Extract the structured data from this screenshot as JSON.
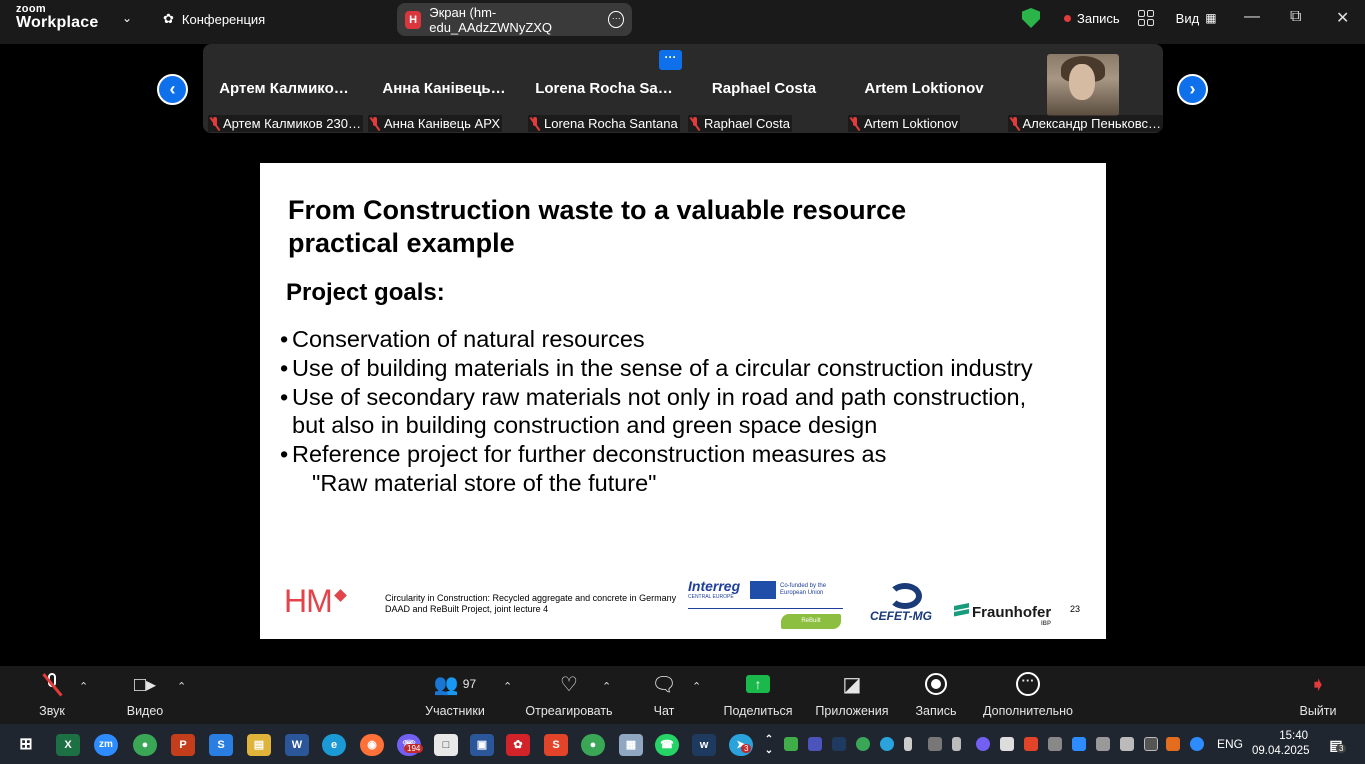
{
  "app": {
    "logo_line1": "zoom",
    "logo_line2": "Workplace",
    "meeting_label": "Конференция",
    "screen_tab": {
      "badge": "H",
      "label": "Экран (hm-edu_AAdzZWNyZXQ"
    },
    "record_label": "Запись",
    "view_label": "Вид",
    "accent": "#0e71eb"
  },
  "gallery": {
    "more_label": "···",
    "participants": [
      {
        "name": "Артем Калмико…",
        "label": "Артем Калмиков 230…"
      },
      {
        "name": "Анна Канівець…",
        "label": "Анна Канівець АРХ"
      },
      {
        "name": "Lorena Rocha Sa…",
        "label": "Lorena Rocha Santana"
      },
      {
        "name": "Raphael Costa",
        "label": "Raphael Costa"
      },
      {
        "name": "Artem Loktionov",
        "label": "Artem Loktionov"
      },
      {
        "name": "",
        "label": "Александр Пеньковс…"
      }
    ]
  },
  "slide": {
    "title_line1": "From Construction waste to a valuable resource",
    "title_line2": "practical example",
    "subtitle": "Project goals:",
    "bullets": [
      "Conservation of natural resources",
      "Use of building materials in the sense of a circular construction industry",
      "Use of secondary raw materials not only in road and path construction,",
      "Reference project for further deconstruction measures as"
    ],
    "bullet3_cont": "but also in building construction and green space design",
    "bullet4_cont": "\"Raw material store of the future\"",
    "hm_logo": "HM",
    "footer_line1": "Circularity in Construction: Recycled aggregate and concrete in Germany",
    "footer_line2": "DAAD and ReBuilt Project, joint lecture 4",
    "interreg": "Interreg",
    "interreg_sub": "CENTRAL EUROPE",
    "eu_text": "Co-funded by the European Union",
    "rebuilt": "ReBuilt",
    "cefet": "CEFET-MG",
    "fraunhofer": "Fraunhofer",
    "fraunhofer_sub": "IBP",
    "page_number": "23"
  },
  "toolbar": {
    "audio": "Звук",
    "video": "Видео",
    "participants": "Участники",
    "participants_count": "97",
    "react": "Отреагировать",
    "chat": "Чат",
    "share": "Поделиться",
    "apps": "Приложения",
    "record": "Запись",
    "more": "Дополнительно",
    "exit": "Выйти"
  },
  "taskbar": {
    "viber_badge": "194",
    "telegram_badge": "3",
    "language": "ENG",
    "time": "15:40",
    "date": "09.04.2025",
    "notif_count": "3"
  }
}
